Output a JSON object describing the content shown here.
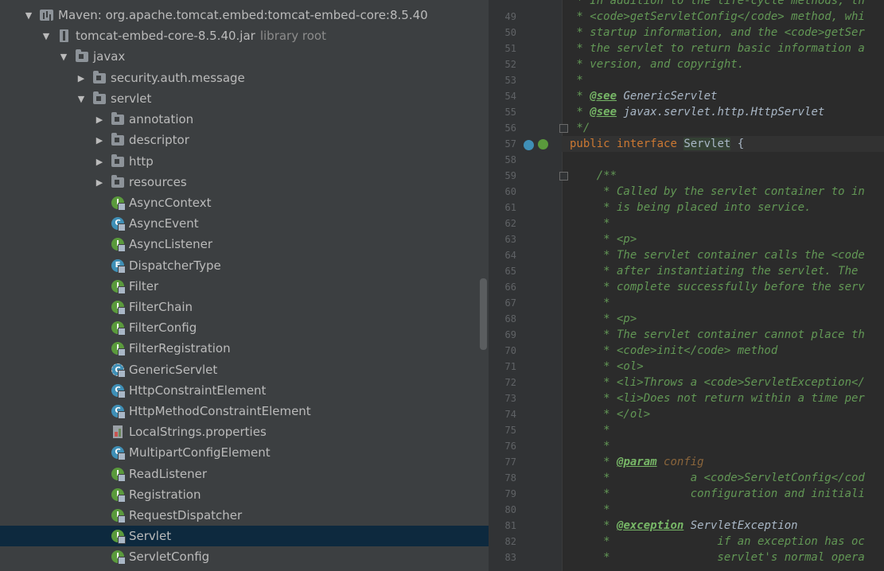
{
  "tree": {
    "maven_library": "Maven: org.apache.tomcat.embed:tomcat-embed-core:8.5.40",
    "jar": "tomcat-embed-core-8.5.40.jar",
    "jar_note": "library root",
    "pkg_javax": "javax",
    "pkg_security": "security.auth.message",
    "pkg_servlet": "servlet",
    "sub_annotation": "annotation",
    "sub_descriptor": "descriptor",
    "sub_http": "http",
    "sub_resources": "resources",
    "classes": [
      {
        "name": "AsyncContext",
        "kind": "I"
      },
      {
        "name": "AsyncEvent",
        "kind": "C"
      },
      {
        "name": "AsyncListener",
        "kind": "I"
      },
      {
        "name": "DispatcherType",
        "kind": "E"
      },
      {
        "name": "Filter",
        "kind": "I"
      },
      {
        "name": "FilterChain",
        "kind": "I"
      },
      {
        "name": "FilterConfig",
        "kind": "I"
      },
      {
        "name": "FilterRegistration",
        "kind": "I"
      },
      {
        "name": "GenericServlet",
        "kind": "A"
      },
      {
        "name": "HttpConstraintElement",
        "kind": "C"
      },
      {
        "name": "HttpMethodConstraintElement",
        "kind": "C"
      },
      {
        "name": "LocalStrings.properties",
        "kind": "P"
      },
      {
        "name": "MultipartConfigElement",
        "kind": "C"
      },
      {
        "name": "ReadListener",
        "kind": "I"
      },
      {
        "name": "Registration",
        "kind": "I"
      },
      {
        "name": "RequestDispatcher",
        "kind": "I"
      },
      {
        "name": "Servlet",
        "kind": "I"
      },
      {
        "name": "ServletConfig",
        "kind": "I"
      }
    ],
    "selected": "Servlet"
  },
  "editor": {
    "lines": [
      {
        "n": "49",
        "t": " * <code>getServletConfig</code> method, whi"
      },
      {
        "n": "50",
        "t": " * startup information, and the <code>getSer"
      },
      {
        "n": "51",
        "t": " * the servlet to return basic information a"
      },
      {
        "n": "52",
        "t": " * version, and copyright."
      },
      {
        "n": "53",
        "t": " *"
      },
      {
        "n": "54",
        "t": " * @see GenericServlet"
      },
      {
        "n": "55",
        "t": " * @see javax.servlet.http.HttpServlet"
      },
      {
        "n": "56",
        "t": " */"
      },
      {
        "n": "57",
        "t": "public interface Servlet {"
      },
      {
        "n": "58",
        "t": ""
      },
      {
        "n": "59",
        "t": "    /**"
      },
      {
        "n": "60",
        "t": "     * Called by the servlet container to in"
      },
      {
        "n": "61",
        "t": "     * is being placed into service."
      },
      {
        "n": "62",
        "t": "     *"
      },
      {
        "n": "63",
        "t": "     * <p>"
      },
      {
        "n": "64",
        "t": "     * The servlet container calls the <code"
      },
      {
        "n": "65",
        "t": "     * after instantiating the servlet. The "
      },
      {
        "n": "66",
        "t": "     * complete successfully before the serv"
      },
      {
        "n": "67",
        "t": "     *"
      },
      {
        "n": "68",
        "t": "     * <p>"
      },
      {
        "n": "69",
        "t": "     * The servlet container cannot place th"
      },
      {
        "n": "70",
        "t": "     * <code>init</code> method"
      },
      {
        "n": "71",
        "t": "     * <ol>"
      },
      {
        "n": "72",
        "t": "     * <li>Throws a <code>ServletException</"
      },
      {
        "n": "73",
        "t": "     * <li>Does not return within a time per"
      },
      {
        "n": "74",
        "t": "     * </ol>"
      },
      {
        "n": "75",
        "t": "     *"
      },
      {
        "n": "76",
        "t": "     *"
      },
      {
        "n": "77",
        "t": "     * @param config"
      },
      {
        "n": "78",
        "t": "     *            a <code>ServletConfig</cod"
      },
      {
        "n": "79",
        "t": "     *            configuration and initiali"
      },
      {
        "n": "80",
        "t": "     *"
      },
      {
        "n": "81",
        "t": "     * @exception ServletException"
      },
      {
        "n": "82",
        "t": "     *                if an exception has oc"
      },
      {
        "n": "83",
        "t": "     *                servlet's normal opera"
      }
    ],
    "top_partial": " * In addition to the life-cycle methods, th",
    "keyword_public": "public",
    "keyword_interface": "interface",
    "class_name": "Servlet",
    "brace": " {",
    "see_tag": "@see",
    "param_tag": "@param",
    "exception_tag": "@exception",
    "param_name": "config"
  },
  "colors": {
    "class_icon": "#3f8fb6",
    "interface_icon": "#5a9a3c",
    "enum_icon": "#3f8fb6",
    "selected_bg": "#0d293e"
  }
}
